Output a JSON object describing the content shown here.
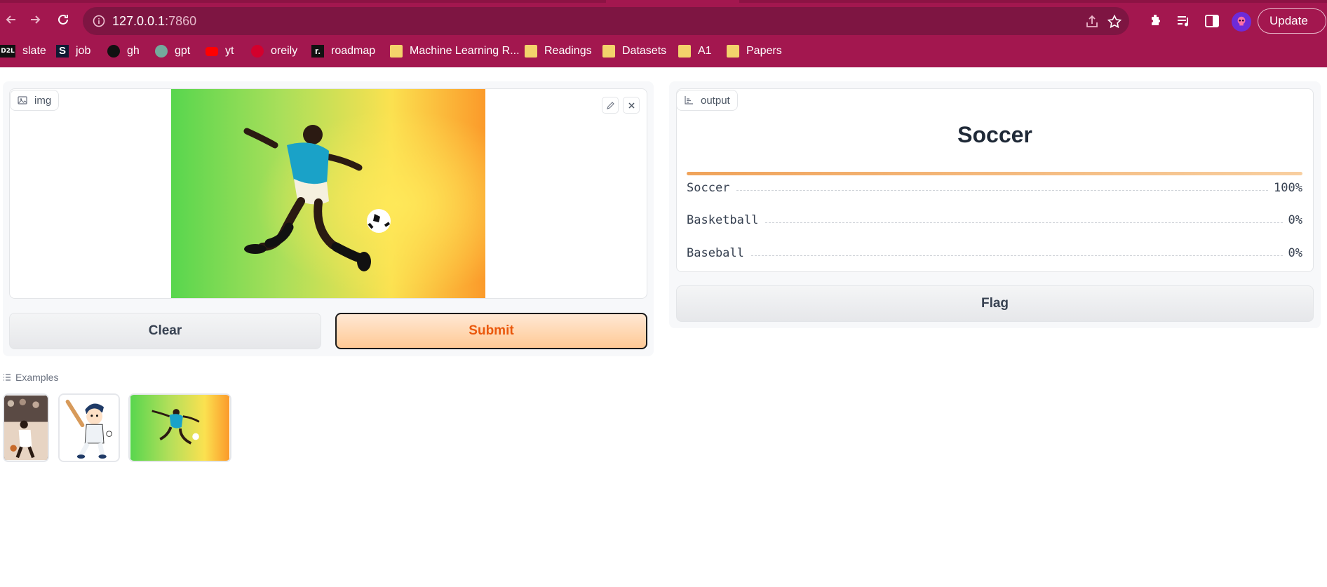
{
  "browser": {
    "url_host": "127.0.0.1",
    "url_port": ":7860",
    "update_label": "Update",
    "bookmarks": [
      {
        "label": "slate",
        "icon": "d2l-icon"
      },
      {
        "label": "job",
        "icon": "s-icon"
      },
      {
        "label": "gh",
        "icon": "github-icon"
      },
      {
        "label": "gpt",
        "icon": "openai-icon"
      },
      {
        "label": "yt",
        "icon": "youtube-icon"
      },
      {
        "label": "oreily",
        "icon": "oreilly-icon"
      },
      {
        "label": "roadmap",
        "icon": "roadmap-icon"
      },
      {
        "label": "Machine Learning R...",
        "icon": "folder-icon"
      },
      {
        "label": "Readings",
        "icon": "folder-icon"
      },
      {
        "label": "Datasets",
        "icon": "folder-icon"
      },
      {
        "label": "A1",
        "icon": "folder-icon"
      },
      {
        "label": "Papers",
        "icon": "folder-icon"
      }
    ],
    "theme_color": "#a3174f"
  },
  "input": {
    "label": "img",
    "clear_label": "Clear",
    "submit_label": "Submit"
  },
  "output": {
    "label": "output",
    "top_label": "Soccer",
    "confidences": [
      {
        "label": "Soccer",
        "value": "100%",
        "fraction": 1.0
      },
      {
        "label": "Basketball",
        "value": "0%",
        "fraction": 0.0
      },
      {
        "label": "Baseball",
        "value": "0%",
        "fraction": 0.0
      }
    ],
    "flag_label": "Flag"
  },
  "examples": {
    "label": "Examples",
    "items": [
      "basketball-photo",
      "baseball-cartoon",
      "soccer-photo"
    ]
  },
  "colors": {
    "accent": "#ea580c",
    "submit_bg": "#ffc995"
  }
}
